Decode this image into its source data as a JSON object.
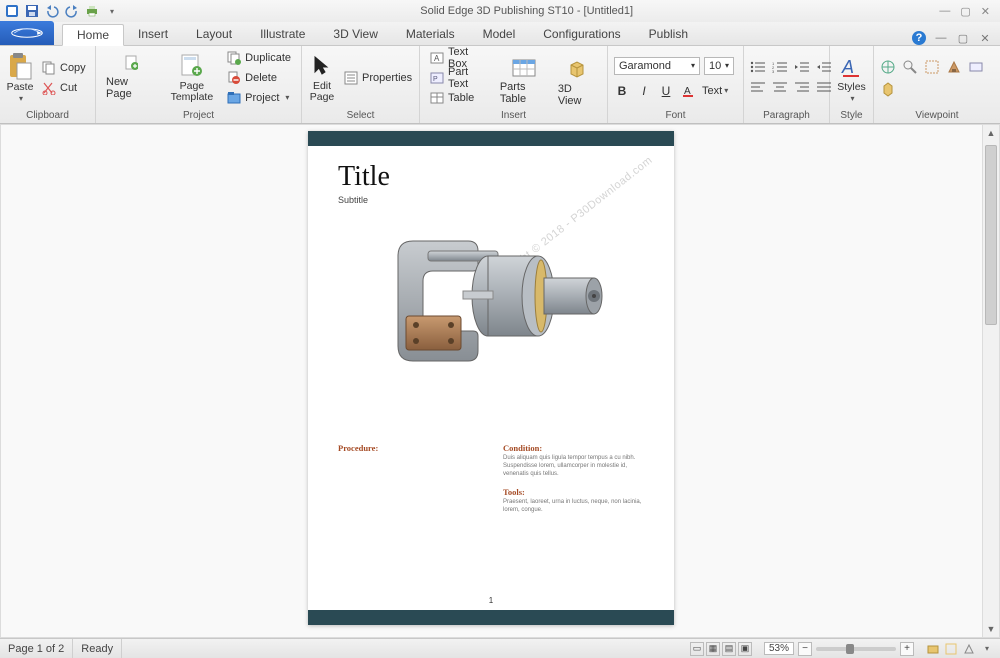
{
  "window": {
    "title": "Solid Edge 3D Publishing  ST10 - [Untitled1]"
  },
  "tabs": {
    "home": "Home",
    "insert": "Insert",
    "layout": "Layout",
    "illustrate": "Illustrate",
    "view3d": "3D View",
    "materials": "Materials",
    "model": "Model",
    "configurations": "Configurations",
    "publish": "Publish"
  },
  "ribbon": {
    "clipboard": {
      "label": "Clipboard",
      "paste": "Paste",
      "copy": "Copy",
      "cut": "Cut"
    },
    "project": {
      "label": "Project",
      "new_page": "New Page",
      "page_template": "Page\nTemplate",
      "duplicate": "Duplicate",
      "delete": "Delete",
      "project": "Project"
    },
    "select": {
      "label": "Select",
      "edit_page": "Edit\nPage",
      "properties": "Properties"
    },
    "insert": {
      "label": "Insert",
      "text_box": "Text Box",
      "part_text": "Part Text",
      "table": "Table",
      "parts_table": "Parts Table",
      "view3d": "3D View"
    },
    "font": {
      "label": "Font",
      "family": "Garamond",
      "size": "10",
      "bold": "B",
      "italic": "I",
      "underline": "U",
      "text": "Text"
    },
    "paragraph": {
      "label": "Paragraph"
    },
    "style": {
      "label": "Style",
      "styles": "Styles"
    },
    "viewpoint": {
      "label": "Viewpoint"
    }
  },
  "doc": {
    "title": "Title",
    "subtitle": "Subtitle",
    "procedure_h": "Procedure:",
    "condition_h": "Condition:",
    "condition_t": "Duis aliquam quis ligula tempor tempus a cu nibh. Suspendisse lorem, ullamcorper in molestie id, venenatis quis tellus.",
    "tools_h": "Tools:",
    "tools_t": "Praesent, laoreet, urna in luctus, neque, non lacinia, lorem, congue.",
    "page_num": "1",
    "watermark": "Copyright © 2018 - P30Download.com"
  },
  "status": {
    "page": "Page 1 of 2",
    "ready": "Ready",
    "zoom": "53%"
  }
}
